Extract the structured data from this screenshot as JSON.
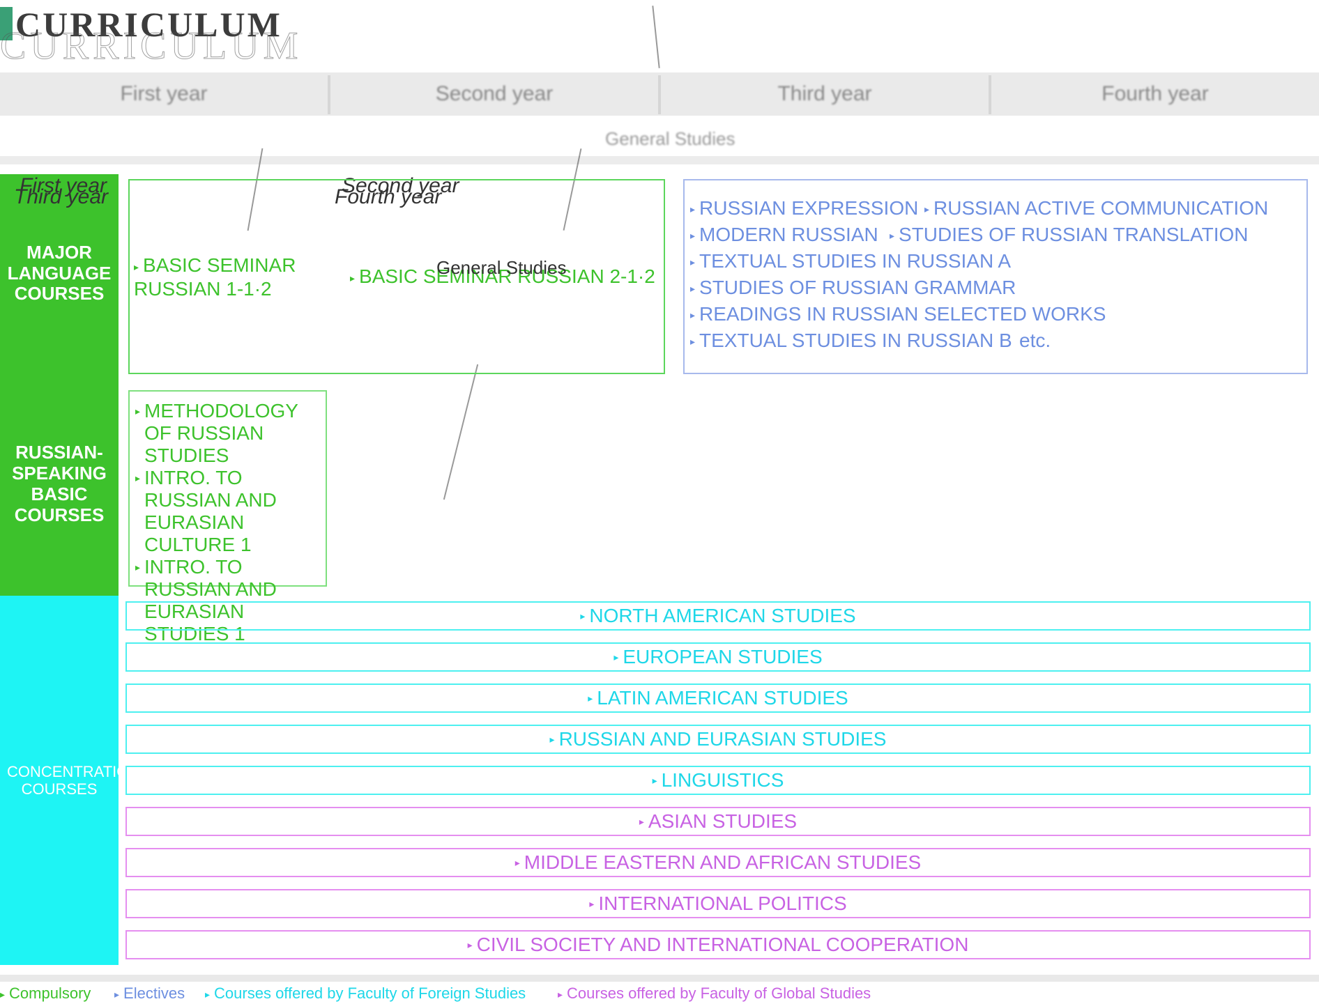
{
  "title": "CURRICULUM",
  "years": [
    "First year",
    "Second year",
    "Third year",
    "Fourth year"
  ],
  "general_studies": "General Studies",
  "ghost_labels": {
    "first_year": "First year",
    "third_year": "Third year",
    "second_year": "Second year",
    "fourth_year": "Fourth year"
  },
  "categories": {
    "major": "MAJOR LANGUAGE COURSES",
    "basic": "RUSSIAN-SPEAKING BASIC COURSES",
    "concentrations": "CONCENTRATIONS COURSES"
  },
  "major_courses": {
    "first": "BASIC SEMINAR RUSSIAN 1-1·2",
    "second": "BASIC SEMINAR RUSSIAN 2-1·2"
  },
  "elective_courses": [
    "RUSSIAN EXPRESSION",
    "RUSSIAN ACTIVE COMMUNICATION",
    "MODERN RUSSIAN",
    "STUDIES OF RUSSIAN TRANSLATION",
    "TEXTUAL STUDIES IN RUSSIAN A",
    "STUDIES OF RUSSIAN GRAMMAR",
    "READINGS IN RUSSIAN SELECTED WORKS",
    "TEXTUAL STUDIES IN RUSSIAN B"
  ],
  "elective_etc": "etc.",
  "basic_courses": [
    "METHODOLOGY OF RUSSIAN STUDIES",
    "INTRO. TO RUSSIAN AND EURASIAN CULTURE 1",
    "INTRO. TO RUSSIAN AND EURASIAN STUDIES 1"
  ],
  "concentrations": [
    {
      "label": "NORTH AMERICAN STUDIES",
      "group": "global"
    },
    {
      "label": "EUROPEAN STUDIES",
      "group": "global"
    },
    {
      "label": "LATIN AMERICAN STUDIES",
      "group": "global"
    },
    {
      "label": "RUSSIAN AND EURASIAN STUDIES",
      "group": "global"
    },
    {
      "label": "LINGUISTICS",
      "group": "global"
    },
    {
      "label": "ASIAN STUDIES",
      "group": "foreign"
    },
    {
      "label": "MIDDLE EASTERN AND AFRICAN STUDIES",
      "group": "foreign"
    },
    {
      "label": "INTERNATIONAL POLITICS",
      "group": "foreign"
    },
    {
      "label": "CIVIL SOCIETY AND INTERNATIONAL COOPERATION",
      "group": "foreign"
    }
  ],
  "legend": [
    {
      "label": "Compulsory",
      "color": "#3dc22c"
    },
    {
      "label": "Electives",
      "color": "#6d8fe0"
    },
    {
      "label": "Courses offered by Faculty of Foreign Studies",
      "color": "#1ed7e8"
    },
    {
      "label": "Courses offered by Faculty of Global Studies",
      "color": "#c862e3"
    }
  ],
  "colors": {
    "compulsory": "#3dc22c",
    "electives": "#6d8fe0",
    "concentration_cyan": "#1ef4f4",
    "foreign_studies": "#1ed7e8",
    "global_studies": "#c862e3"
  }
}
